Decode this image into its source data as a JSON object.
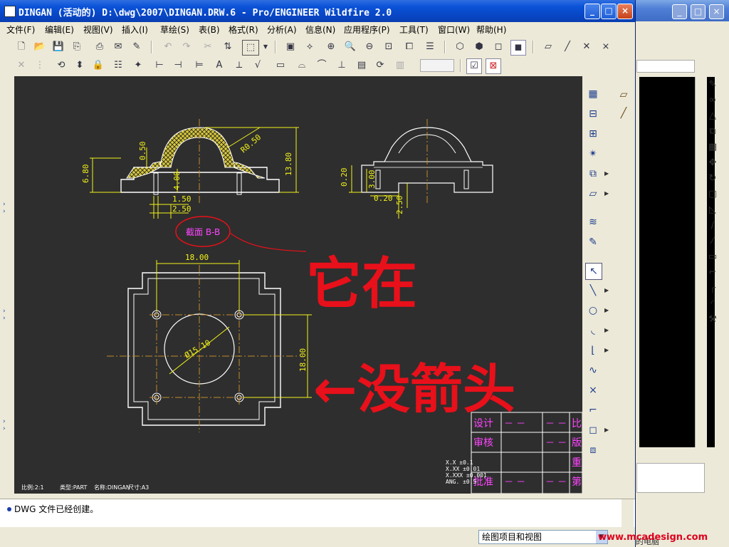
{
  "window": {
    "title": "DINGAN (活动的) D:\\dwg\\2007\\DINGAN.DRW.6 - Pro/ENGINEER Wildfire 2.0",
    "controls": [
      "_",
      "□",
      "×"
    ]
  },
  "menu": [
    "文件(F)",
    "编辑(E)",
    "视图(V)",
    "插入(I)",
    "草绘(S)",
    "表(B)",
    "格式(R)",
    "分析(A)",
    "信息(N)",
    "应用程序(P)",
    "工具(T)",
    "窗口(W)",
    "帮助(H)"
  ],
  "drawing": {
    "dims": {
      "top_left_height": "6.80",
      "fillet_r": "0.50",
      "radius": "R0.50",
      "overall_height": "13.80",
      "small_height": "4.00",
      "dim_1_50": "1.50",
      "dim_2_50": "2.50",
      "rv_0_20a": "0.20",
      "rv_3_00": "3.00",
      "rv_0_20b": "0.20",
      "rv_2_50": "2.50",
      "plan_width": "18.00",
      "plan_height": "18.00",
      "diameter": "Ø15.10"
    },
    "section_label": "截面 B-B",
    "annotation_line1": "它在",
    "annotation_line2": "←没箭头",
    "title_block": {
      "rows": [
        {
          "label": "设计",
          "dash1": "－ －",
          "dash2": "－ －",
          "right": "比"
        },
        {
          "label": "审核",
          "dash1": "",
          "dash2": "－ －",
          "right": "版"
        },
        {
          "label": "",
          "dash1": "",
          "dash2": "",
          "right": "重"
        },
        {
          "label": "批准",
          "dash1": "－ －",
          "dash2": "－ －",
          "right": "第"
        }
      ]
    },
    "tolerances": [
      "X.X   ±0.1",
      "X.XX  ±0.01",
      "X.XXX ±0.001",
      "ANG.  ±0.5"
    ],
    "footer": {
      "scale": "比例:2:1",
      "type": "类型:PART",
      "name": "名称:DINGAN",
      "size": "尺寸:A3"
    }
  },
  "status": {
    "message": "DWG 文件已经创建。",
    "filter": "绘图项目和视图"
  },
  "watermark": "www.mcadesign.com",
  "bg_window_text": "的电脑",
  "colors": {
    "titlebar": "#0a52d8",
    "canvas": "#2e2e2e",
    "dimension": "#f2f21a",
    "geometry": "#ffffff",
    "centerline": "#c08a2a",
    "annotation": "#e8101a",
    "titleblock_text": "#ff44ff"
  }
}
